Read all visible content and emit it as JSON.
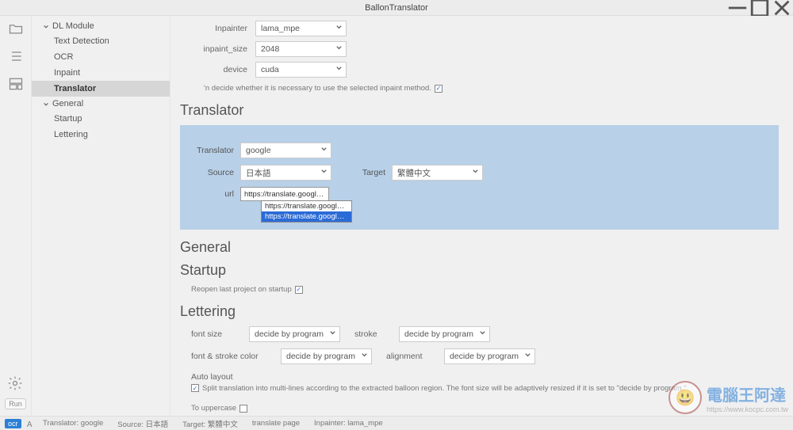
{
  "window": {
    "title": "BallonTranslator"
  },
  "sidebar": {
    "groups": [
      {
        "label": "DL Module",
        "items": [
          {
            "label": "Text Detection",
            "key": "text-detection"
          },
          {
            "label": "OCR",
            "key": "ocr"
          },
          {
            "label": "Inpaint",
            "key": "inpaint"
          },
          {
            "label": "Translator",
            "key": "translator",
            "selected": true
          }
        ]
      },
      {
        "label": "General",
        "items": [
          {
            "label": "Startup",
            "key": "startup"
          },
          {
            "label": "Lettering",
            "key": "lettering"
          }
        ]
      }
    ]
  },
  "inpaint": {
    "inpainter_label": "Inpainter",
    "inpainter_value": "lama_mpe",
    "size_label": "inpaint_size",
    "size_value": "2048",
    "device_label": "device",
    "device_value": "cuda",
    "note": "'n decide whether it is necessary to use the selected inpaint method."
  },
  "translator": {
    "heading": "Translator",
    "translator_label": "Translator",
    "translator_value": "google",
    "source_label": "Source",
    "source_value": "日本語",
    "target_label": "Target",
    "target_value": "繁體中文",
    "url_label": "url",
    "url_value": "https://translate.google.com/m",
    "url_options": [
      "https://translate.google.cn/m",
      "https://translate.google.com/m"
    ],
    "url_selected_index": 1
  },
  "general": {
    "heading": "General"
  },
  "startup": {
    "heading": "Startup",
    "reopen_label": "Reopen last project on startup"
  },
  "lettering": {
    "heading": "Lettering",
    "fontsize_label": "font size",
    "fontsize_value": "decide by program",
    "stroke_label": "stroke",
    "stroke_value": "decide by program",
    "fontstrokecolor_label": "font & stroke color",
    "fontstrokecolor_value": "decide by program",
    "alignment_label": "alignment",
    "alignment_value": "decide by program",
    "autolayout_label": "Auto layout",
    "autolayout_note": "Split translation into multi-lines according to the extracted balloon region. The font size will be adaptively resized if it is set to \"decide by program.\"",
    "uppercase_label": "To uppercase"
  },
  "statusbar": {
    "ocr_badge": "ocr",
    "items": [
      "Translator: google",
      "Source: 日本語",
      "Target: 繁體中文",
      "translate page",
      "Inpainter: lama_mpe"
    ]
  },
  "run_label": "Run",
  "watermark": {
    "big": "電腦王阿達",
    "small": "https://www.kocpc.com.tw"
  }
}
